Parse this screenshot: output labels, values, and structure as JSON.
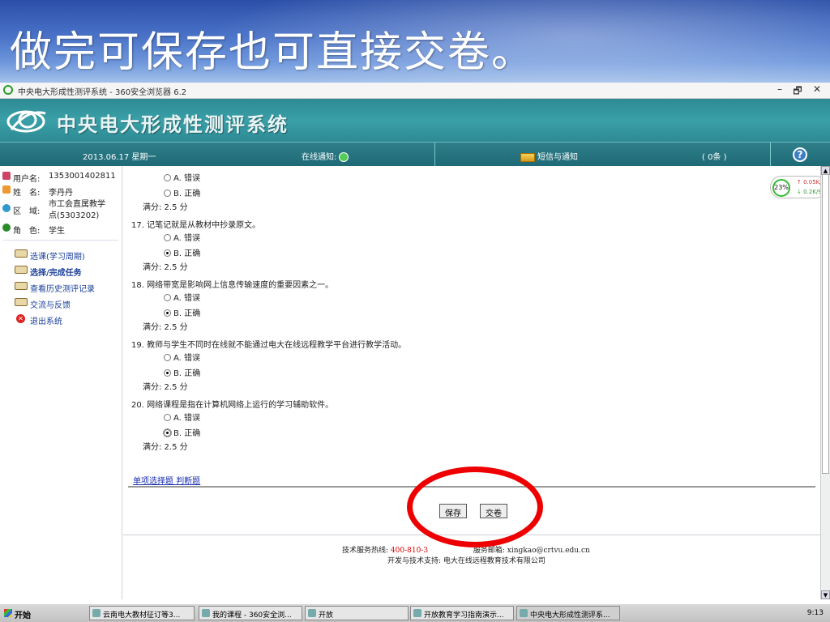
{
  "slide": {
    "title": "做完可保存也可直接交卷。"
  },
  "browser": {
    "title": "中央电大形成性测评系统 - 360安全浏览器 6.2",
    "min": "–",
    "restore": "🗗",
    "close": "✕"
  },
  "header": {
    "site_title": "中央电大形成性测评系统"
  },
  "infobar": {
    "date": "2013.06.17 星期一",
    "notice_label": "在线通知:",
    "messages_label": "短信与通知",
    "count": "( 0条 )",
    "help": "?"
  },
  "user": {
    "username_label": "用户名:",
    "username": "1353001402811",
    "name_label": "姓　名:",
    "name": "李丹丹",
    "region_label": "区　域:",
    "region_line1": "市工会直属教学",
    "region_line2": "点(5303202)",
    "role_label": "角　色:",
    "role": "学生"
  },
  "menu": [
    {
      "label": "选课(学习周期)"
    },
    {
      "label": "选择/完成任务"
    },
    {
      "label": "查看历史测评记录"
    },
    {
      "label": "交流与反馈"
    },
    {
      "label": "退出系统"
    }
  ],
  "questions": {
    "q16": {
      "opt_a": "A. 错误",
      "opt_b": "B. 正确",
      "score": "满分: 2.5 分"
    },
    "q17": {
      "text": "17. 记笔记就是从教材中抄录原文。",
      "opt_a": "A. 错误",
      "opt_b": "B. 正确",
      "score": "满分: 2.5 分"
    },
    "q18": {
      "text": "18. 网络带宽是影响网上信息传输速度的重要因素之一。",
      "opt_a": "A. 错误",
      "opt_b": "B. 正确",
      "score": "满分: 2.5 分"
    },
    "q19": {
      "text": "19. 教师与学生不同时在线就不能通过电大在线远程教学平台进行教学活动。",
      "opt_a": "A. 错误",
      "opt_b": "B. 正确",
      "score": "满分: 2.5 分"
    },
    "q20": {
      "text": "20. 网络课程是指在计算机网络上运行的学习辅助软件。",
      "opt_a": "A. 错误",
      "opt_b": "B. 正确",
      "score": "满分: 2.5 分"
    }
  },
  "type_links": {
    "single": "单项选择题",
    "judge": "判断题"
  },
  "buttons": {
    "save": "保存",
    "submit": "交卷"
  },
  "footer": {
    "hotline_label": "技术服务热线:",
    "hotline": "400-810-3",
    "email_label": "服务邮箱:",
    "email": "xingkao@crtvu.edu.cn",
    "support": "开发与技术支持: 电大在线远程教育技术有限公司"
  },
  "network": {
    "percent": "23%",
    "up": "↑ 0.05K/S",
    "down": "↓ 0.2K/S"
  },
  "taskbar": {
    "start": "开始",
    "items": [
      "云南电大教材征订等3...",
      "我的课程 - 360安全浏...",
      "开放",
      "开放教育学习指南演示...",
      "中央电大形成性测评系..."
    ],
    "clock": "9:13"
  }
}
